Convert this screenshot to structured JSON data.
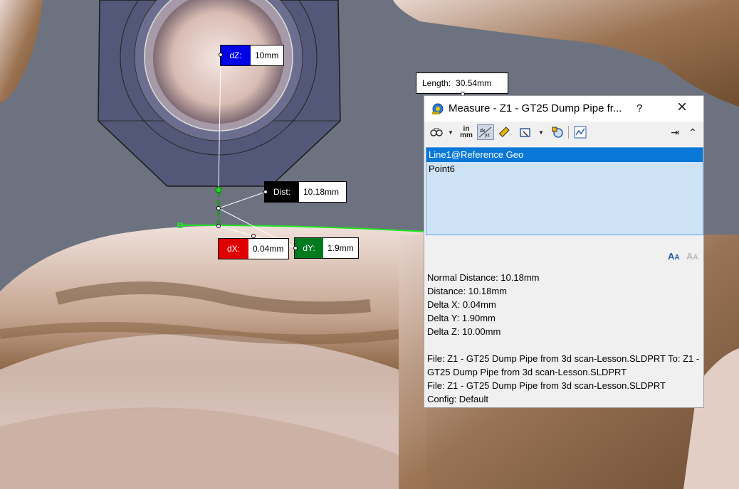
{
  "callouts": {
    "length": {
      "key": "Length:",
      "value": "30.54mm"
    },
    "dz": {
      "key": "dZ:",
      "value": "10mm",
      "color": "#0000e6"
    },
    "dist": {
      "key": "Dist:",
      "value": "10.18mm",
      "color": "#000000"
    },
    "dx": {
      "key": "dX:",
      "value": "0.04mm",
      "color": "#e00000"
    },
    "dy": {
      "key": "dY:",
      "value": "1.9mm",
      "color": "#007a1e"
    }
  },
  "dialog": {
    "title": "Measure - Z1 - GT25 Dump Pipe fr...",
    "help": "?",
    "close": "×",
    "toolbar": {
      "units_top": "in",
      "units_bottom": "mm"
    },
    "selections": [
      "Line1@Reference Geo",
      "Point6"
    ],
    "results": {
      "normal_distance": "Normal Distance: 10.18mm",
      "distance": "Distance: 10.18mm",
      "delta_x": "Delta X: 0.04mm",
      "delta_y": "Delta Y: 1.90mm",
      "delta_z": "Delta Z: 10.00mm",
      "file_to": "File: Z1 - GT25 Dump Pipe from 3d scan-Lesson.SLDPRT To: Z1 - GT25 Dump Pipe from 3d scan-Lesson.SLDPRT",
      "file": "File: Z1 - GT25 Dump Pipe from 3d scan-Lesson.SLDPRT",
      "config": "Config: Default"
    }
  },
  "colors": {
    "background": "#6c7280",
    "mesh": "#e2cbc4",
    "mesh_shadow": "#7a5636",
    "nut": "#545878",
    "highlight_edge": "#22e622"
  }
}
